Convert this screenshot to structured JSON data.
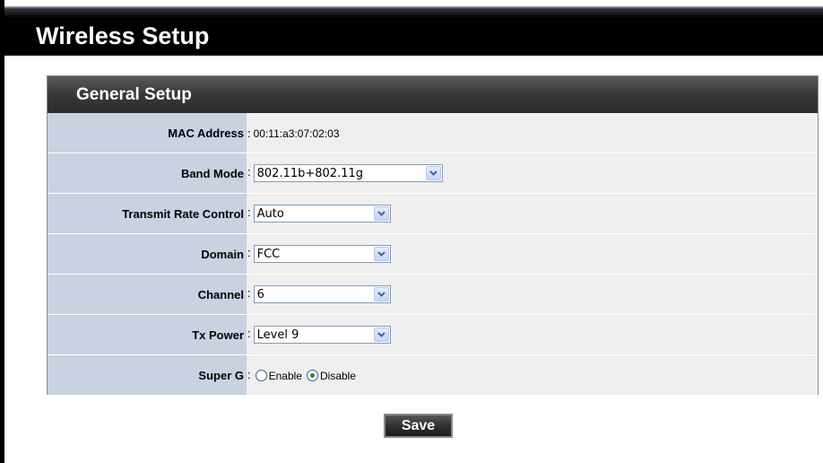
{
  "page": {
    "title": "Wireless Setup"
  },
  "panel": {
    "title": "General Setup"
  },
  "form": {
    "separator": ":",
    "mac_address": {
      "label": "MAC Address",
      "value": "00:11:a3:07:02:03"
    },
    "band_mode": {
      "label": "Band Mode",
      "selected": "802.11b+802.11g"
    },
    "transmit_rate_control": {
      "label": "Transmit Rate Control",
      "selected": "Auto"
    },
    "domain": {
      "label": "Domain",
      "selected": "FCC"
    },
    "channel": {
      "label": "Channel",
      "selected": "6"
    },
    "tx_power": {
      "label": "Tx Power",
      "selected": "Level 9"
    },
    "super_g": {
      "label": "Super G",
      "options": [
        "Enable",
        "Disable"
      ],
      "selected": "Disable"
    }
  },
  "actions": {
    "save_label": "Save"
  },
  "colors": {
    "label_column_bg": "#c8d2e0",
    "value_column_bg": "#efefef",
    "header_bg": "#000000",
    "panel_header_bg": "#3a3a3a",
    "radio_checked_dot": "#2a8a2a"
  },
  "icons": {
    "dropdown": "chevron-down-icon",
    "radio_on": "radio-checked-icon",
    "radio_off": "radio-unchecked-icon"
  }
}
